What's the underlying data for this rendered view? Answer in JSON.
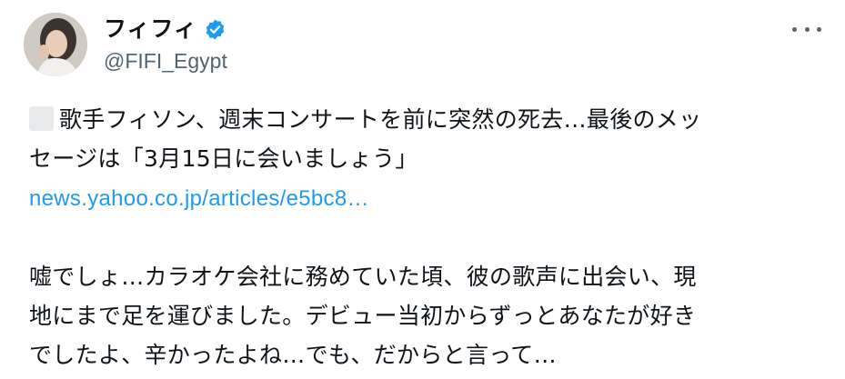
{
  "author": {
    "display_name": "フィフィ",
    "handle": "@FIFI_Egypt",
    "verified_icon": "verified-badge-icon",
    "avatar_icon": "avatar-photo"
  },
  "menu": {
    "more_icon": "more-horizontal-icon"
  },
  "colors": {
    "link": "#1d9bf0",
    "text": "#0f1419",
    "secondary": "#536471",
    "verified": "#1d9bf0"
  },
  "tweet": {
    "headline_line1": "歌手フィソン、週末コンサートを前に突然の死去…最後のメッ",
    "headline_line2": "セージは「3月15日に会いましょう」",
    "link_text": "news.yahoo.co.jp/articles/e5bc8…",
    "body_line1": "嘘でしょ…カラオケ会社に務めていた頃、彼の歌声に出会い、現",
    "body_line2": "地にまで足を運びました。デビュー当初からずっとあなたが好き",
    "body_line3": "でしたよ、辛かったよね…でも、だからと言って…"
  }
}
